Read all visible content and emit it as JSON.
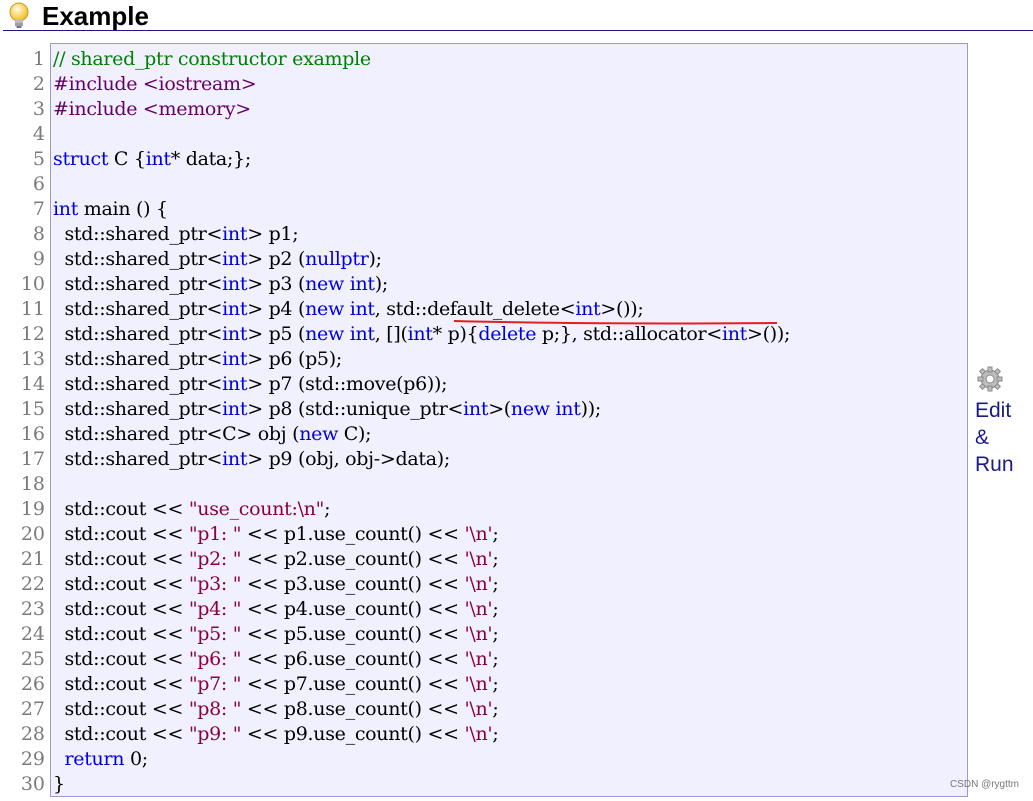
{
  "header": {
    "title": "Example",
    "icon": "lightbulb-icon"
  },
  "code": {
    "line_numbers": [
      "1",
      "2",
      "3",
      "4",
      "5",
      "6",
      "7",
      "8",
      "9",
      "10",
      "11",
      "12",
      "13",
      "14",
      "15",
      "16",
      "17",
      "18",
      "19",
      "20",
      "21",
      "22",
      "23",
      "24",
      "25",
      "26",
      "27",
      "28",
      "29",
      "30"
    ],
    "lines": [
      "// shared_ptr constructor example",
      "#include <iostream>",
      "#include <memory>",
      "",
      "struct C {int* data;};",
      "",
      "int main () {",
      "  std::shared_ptr<int> p1;",
      "  std::shared_ptr<int> p2 (nullptr);",
      "  std::shared_ptr<int> p3 (new int);",
      "  std::shared_ptr<int> p4 (new int, std::default_delete<int>());",
      "  std::shared_ptr<int> p5 (new int, [](int* p){delete p;}, std::allocator<int>());",
      "  std::shared_ptr<int> p6 (p5);",
      "  std::shared_ptr<int> p7 (std::move(p6));",
      "  std::shared_ptr<int> p8 (std::unique_ptr<int>(new int));",
      "  std::shared_ptr<C> obj (new C);",
      "  std::shared_ptr<int> p9 (obj, obj->data);",
      "",
      "  std::cout << \"use_count:\\n\";",
      "  std::cout << \"p1: \" << p1.use_count() << '\\n';",
      "  std::cout << \"p2: \" << p2.use_count() << '\\n';",
      "  std::cout << \"p3: \" << p3.use_count() << '\\n';",
      "  std::cout << \"p4: \" << p4.use_count() << '\\n';",
      "  std::cout << \"p5: \" << p5.use_count() << '\\n';",
      "  std::cout << \"p6: \" << p6.use_count() << '\\n';",
      "  std::cout << \"p7: \" << p7.use_count() << '\\n';",
      "  std::cout << \"p8: \" << p8.use_count() << '\\n';",
      "  std::cout << \"p9: \" << p9.use_count() << '\\n';",
      "  return 0;",
      "}"
    ],
    "highlight_color": "#e02020"
  },
  "edit_run": {
    "label_edit": "Edit",
    "label_amp": "&",
    "label_run": "Run",
    "icon": "gear-icon"
  },
  "watermark": "CSDN @rygttm"
}
